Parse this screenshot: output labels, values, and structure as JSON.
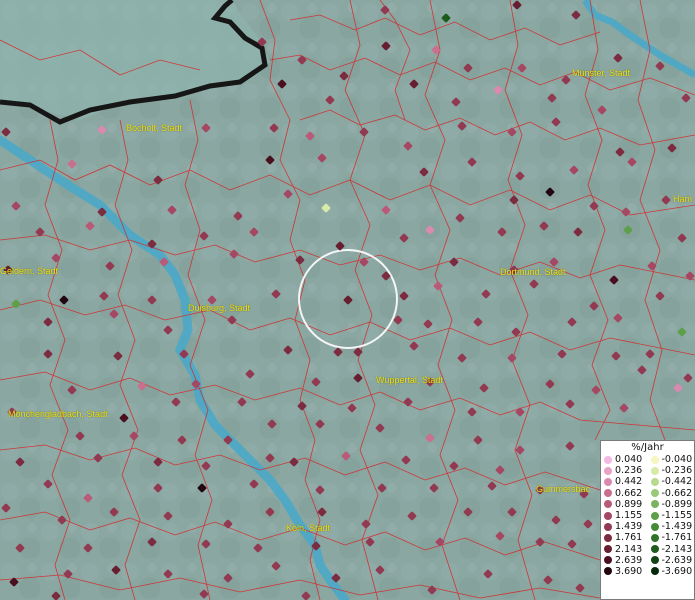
{
  "map": {
    "cities": [
      {
        "name": "Münster, Stadt",
        "dx": 0,
        "dy": 0
      },
      {
        "name": "Bocholt, Stadt"
      },
      {
        "name": "Ham"
      },
      {
        "name": "Dortmund, Stadt"
      },
      {
        "name": "Duisburg, Stadt"
      },
      {
        "name": "Geldern, Stadt"
      },
      {
        "name": "Wuppertal, Stadt"
      },
      {
        "name": "Mönchengladbach, Stadt"
      },
      {
        "name": "Gummersbac"
      },
      {
        "name": "Köln, Stadt"
      }
    ]
  },
  "legend": {
    "title": "%/Jahr",
    "positive": [
      {
        "label": "0.040",
        "color": "#f6b8e0"
      },
      {
        "label": "0.236",
        "color": "#e8a0c4"
      },
      {
        "label": "0.442",
        "color": "#d98aae"
      },
      {
        "label": "0.662",
        "color": "#c8708e"
      },
      {
        "label": "0.899",
        "color": "#b85a78"
      },
      {
        "label": "1.155",
        "color": "#a44864"
      },
      {
        "label": "1.439",
        "color": "#923a52"
      },
      {
        "label": "1.761",
        "color": "#7c2c40"
      },
      {
        "label": "2.143",
        "color": "#661e30"
      },
      {
        "label": "2.639",
        "color": "#4a1020"
      },
      {
        "label": "3.690",
        "color": "#220610"
      }
    ],
    "negative": [
      {
        "label": "-0.040",
        "color": "#f6f6c0"
      },
      {
        "label": "-0.236",
        "color": "#d8eaa8"
      },
      {
        "label": "-0.442",
        "color": "#b8da90"
      },
      {
        "label": "-0.662",
        "color": "#98c878"
      },
      {
        "label": "-0.899",
        "color": "#7ab460"
      },
      {
        "label": "-1.155",
        "color": "#5ea04a"
      },
      {
        "label": "-1.439",
        "color": "#468a38"
      },
      {
        "label": "-1.761",
        "color": "#30742a"
      },
      {
        "label": "-2.143",
        "color": "#1e5c1e"
      },
      {
        "label": "-2.639",
        "color": "#104414"
      },
      {
        "label": "-3.690",
        "color": "#062a0a"
      }
    ]
  }
}
